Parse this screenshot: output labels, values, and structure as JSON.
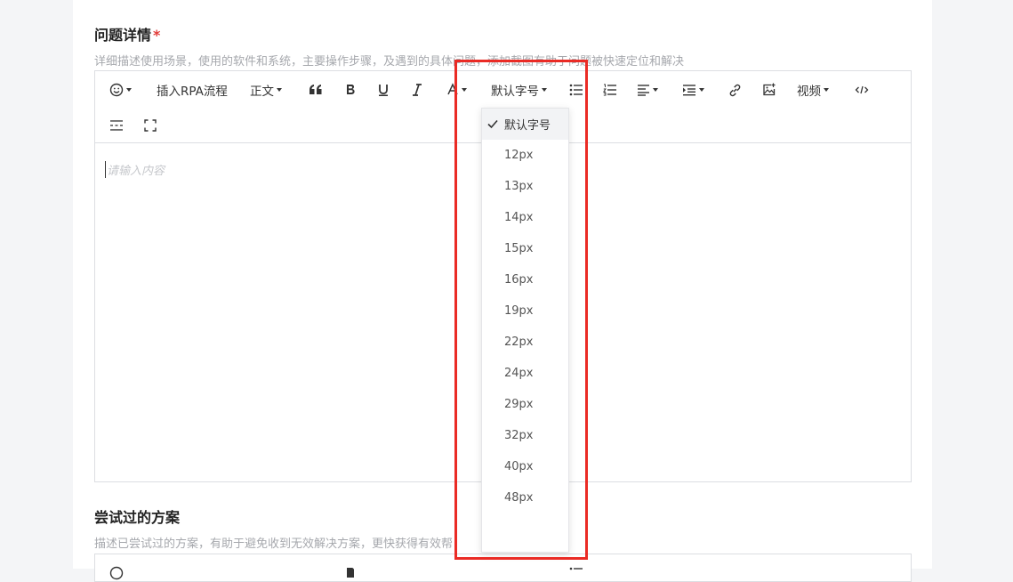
{
  "section1": {
    "title": "问题详情",
    "required_mark": "*",
    "description": "详细描述使用场景，使用的软件和系统，主要操作步骤，及遇到的具体问题，添加截图有助于问题被快速定位和解决"
  },
  "toolbar": {
    "insert_rpa_label": "插入RPA流程",
    "heading_label": "正文",
    "font_size_label": "默认字号",
    "video_label": "视频"
  },
  "editor": {
    "placeholder": "请输入内容"
  },
  "font_size_dropdown": {
    "selected": "默认字号",
    "options": [
      "默认字号",
      "12px",
      "13px",
      "14px",
      "15px",
      "16px",
      "19px",
      "22px",
      "24px",
      "29px",
      "32px",
      "40px",
      "48px"
    ]
  },
  "section2": {
    "title": "尝试过的方案",
    "description": "描述已尝试过的方案，有助于避免收到无效解决方案，更快获得有效帮"
  },
  "colors": {
    "accent_red": "#ea2b25",
    "required_red": "#e23c39",
    "border": "#dcdee2"
  }
}
